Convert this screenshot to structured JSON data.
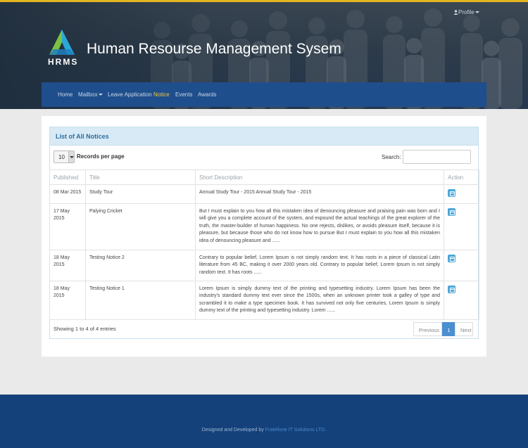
{
  "app": {
    "logo_text": "HRMS",
    "title": "Human Resourse Management Sysem"
  },
  "nav": {
    "items": [
      {
        "label": "Home",
        "active": false,
        "dropdown": false
      },
      {
        "label": "Mailbox",
        "active": false,
        "dropdown": true
      },
      {
        "label": "Leave Application",
        "active": false,
        "dropdown": false
      },
      {
        "label": "Notice",
        "active": true,
        "dropdown": false
      },
      {
        "label": "Events",
        "active": false,
        "dropdown": false
      },
      {
        "label": "Awards",
        "active": false,
        "dropdown": false
      }
    ],
    "profile_label": "Profile",
    "profile_icon": "user-icon"
  },
  "panel": {
    "title": "List of All Notices",
    "length_value": "10",
    "records_per_page_label": "Records per page",
    "search_label": "Search:",
    "search_value": ""
  },
  "table": {
    "columns": [
      "Published",
      "Title",
      "Short Description",
      "Action"
    ],
    "rows": [
      {
        "published": "08 Mar 2015",
        "title": "Study Tour",
        "description": "Annual Study Tour - 2015 Annual Study Tour - 2015",
        "action_icon": "calendar-icon"
      },
      {
        "published": "17 May 2015",
        "title": "Palying Cricket",
        "description": "But I must explain to you how all this mistaken idea of denouncing pleasure and praising pain was born and I will give you a complete account of the system, and expound the actual teachings of the great explorer of the truth, the master-builder of human happiness. No one rejects, dislikes, or avoids pleasure itself, because it is pleasure, but because those who do not know how to pursue But I must explain to you how all this mistaken idea of denouncing pleasure and ......",
        "action_icon": "calendar-icon"
      },
      {
        "published": "18 May 2015",
        "title": "Testing Notice 2",
        "description": "Contrary to popular belief, Lorem Ipsum is not simply random text. It has roots in a piece of classical Latin literature from 45 BC, making it over 2000 years old. Contrary to popular belief, Lorem Ipsum is not simply random text. It has roots ......",
        "action_icon": "calendar-icon"
      },
      {
        "published": "18 May 2015",
        "title": "Testing Notice 1",
        "description": "Lorem Ipsum is simply dummy text of the printing and typesetting industry. Lorem Ipsum has been the industry's standard dummy text ever since the 1500s, when an unknown printer took a galley of type and scrambled it to make a type specimen book. It has survived not only five centuries, Lorem Ipsum is simply dummy text of the printing and typesetting industry. Lorem ......",
        "action_icon": "calendar-icon"
      }
    ]
  },
  "footer_table": {
    "info": "Showing 1 to 4 of 4 entries",
    "prev_label": "Previous",
    "current_page": "1",
    "next_label": "Next"
  },
  "footer": {
    "text": "Designed and Developed by",
    "company": "Fratellone IT Solutions LTD."
  },
  "colors": {
    "accent_stripe": "#e3b51f",
    "navbar": "#1f4e8c",
    "active_nav": "#f4c63d",
    "footer": "#14417a",
    "action_button": "#4aa7d8"
  }
}
